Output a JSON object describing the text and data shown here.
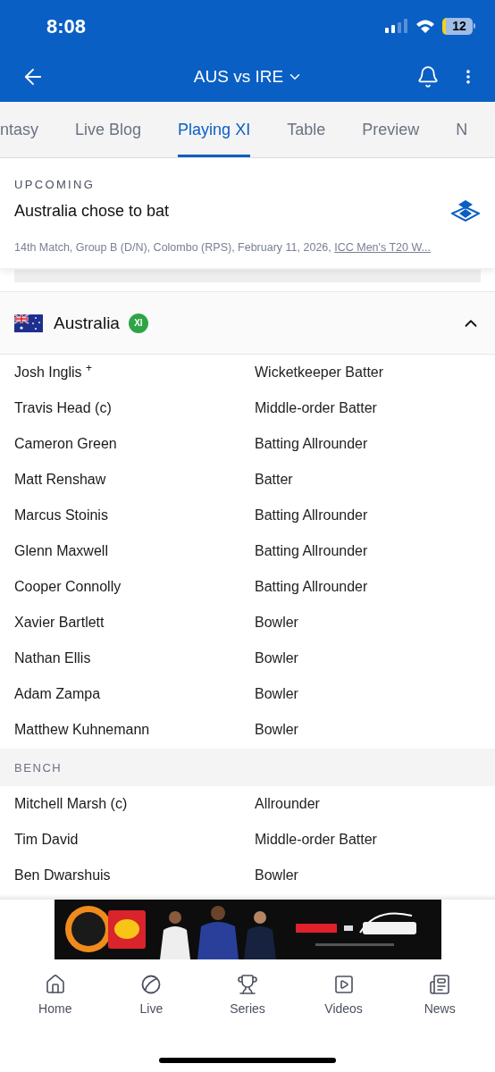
{
  "status_bar": {
    "time": "8:08",
    "battery": "12"
  },
  "header": {
    "title": "AUS vs IRE"
  },
  "tabs": [
    {
      "label": "ntasy",
      "selected": false
    },
    {
      "label": "Live Blog",
      "selected": false
    },
    {
      "label": "Playing XI",
      "selected": true
    },
    {
      "label": "Table",
      "selected": false
    },
    {
      "label": "Preview",
      "selected": false
    },
    {
      "label": "N",
      "selected": false
    }
  ],
  "match_card": {
    "status": "UPCOMING",
    "headline": "Australia chose to bat",
    "details": "14th Match, Group B (D/N), Colombo (RPS), February 11, 2026, ",
    "series_link": "ICC Men's T20 W..."
  },
  "team": {
    "name": "Australia",
    "badge": "XI",
    "expanded": true
  },
  "players": [
    {
      "name": "Josh Inglis $^{+}$",
      "role": "Wicketkeeper Batter"
    },
    {
      "name": "Travis Head (c)",
      "role": "Middle-order Batter"
    },
    {
      "name": "Cameron Green",
      "role": "Batting Allrounder"
    },
    {
      "name": "Matt Renshaw",
      "role": "Batter"
    },
    {
      "name": "Marcus Stoinis",
      "role": "Batting Allrounder"
    },
    {
      "name": "Glenn Maxwell",
      "role": "Batting Allrounder"
    },
    {
      "name": "Cooper Connolly",
      "role": "Batting Allrounder"
    },
    {
      "name": "Xavier Bartlett",
      "role": "Bowler"
    },
    {
      "name": "Nathan Ellis",
      "role": "Bowler"
    },
    {
      "name": "Adam Zampa",
      "role": "Bowler"
    },
    {
      "name": "Matthew Kuhnemann",
      "role": "Bowler"
    }
  ],
  "bench": {
    "title": "BENCH",
    "players": [
      {
        "name": "Mitchell Marsh (c)",
        "role": "Allrounder"
      },
      {
        "name": "Tim David",
        "role": "Middle-order Batter"
      },
      {
        "name": "Ben Dwarshuis",
        "role": "Bowler"
      }
    ]
  },
  "bottom_nav": [
    {
      "label": "Home"
    },
    {
      "label": "Live"
    },
    {
      "label": "Series"
    },
    {
      "label": "Videos"
    },
    {
      "label": "News"
    }
  ]
}
